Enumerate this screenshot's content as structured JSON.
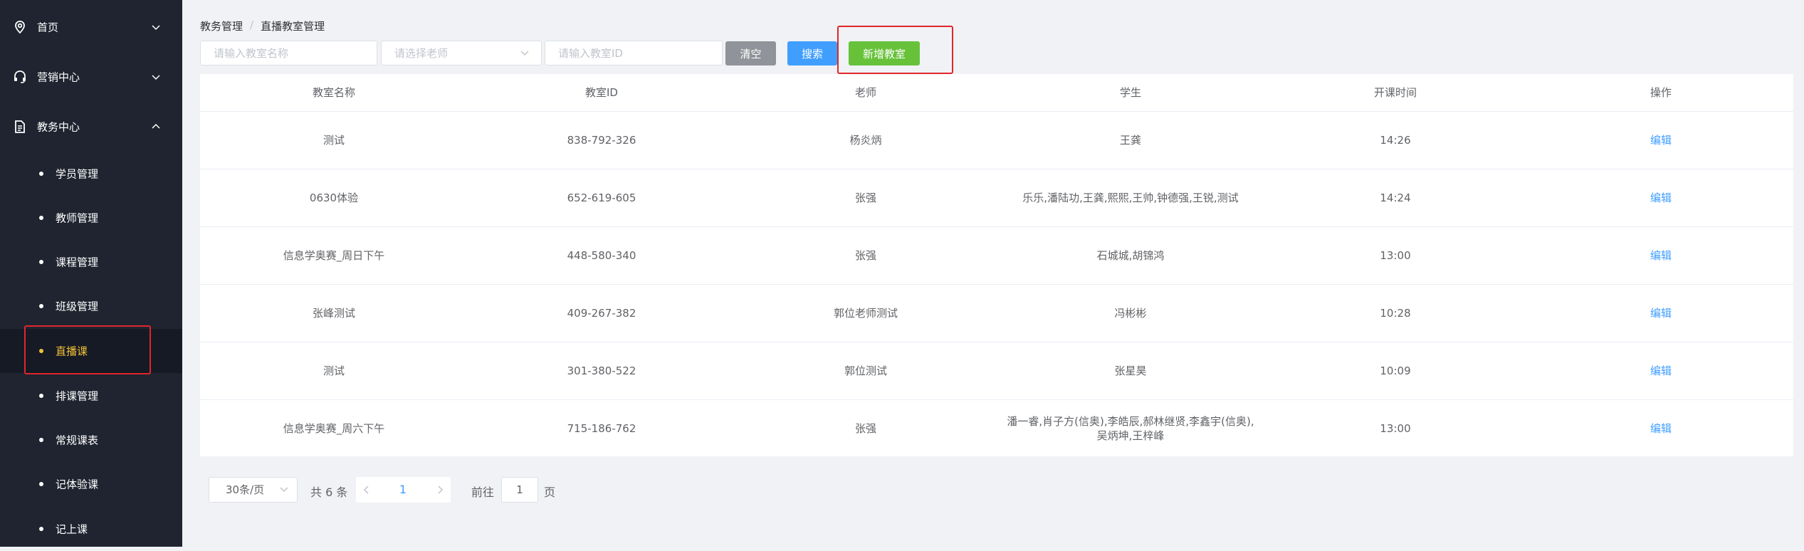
{
  "sidebar": {
    "menus": [
      {
        "label": "首页",
        "icon": "location-pin-icon",
        "state": "collapsed"
      },
      {
        "label": "营销中心",
        "icon": "headset-icon",
        "state": "collapsed"
      },
      {
        "label": "教务中心",
        "icon": "document-icon",
        "state": "expanded"
      }
    ],
    "submenu": [
      {
        "label": "学员管理"
      },
      {
        "label": "教师管理"
      },
      {
        "label": "课程管理"
      },
      {
        "label": "班级管理"
      },
      {
        "label": "直播课",
        "active": true
      },
      {
        "label": "排课管理"
      },
      {
        "label": "常规课表"
      },
      {
        "label": "记体验课"
      },
      {
        "label": "记上课"
      }
    ],
    "active_color": "#f2c037",
    "background": "#1f2430"
  },
  "breadcrumb": {
    "items": [
      "教务管理",
      "直播教室管理"
    ],
    "separator": "/"
  },
  "filters": {
    "name_placeholder": "请输入教室名称",
    "teacher_placeholder": "请选择老师",
    "id_placeholder": "请输入教室ID"
  },
  "buttons": {
    "clear": "清空",
    "search": "搜索",
    "add": "新增教室",
    "clear_color": "#909399",
    "search_color": "#409eff",
    "add_color": "#67c23a"
  },
  "table": {
    "headers": [
      "教室名称",
      "教室ID",
      "老师",
      "学生",
      "开课时间",
      "操作"
    ],
    "rows": [
      {
        "name": "测试",
        "id": "838-792-326",
        "teacher": "杨炎炳",
        "students": "王龚",
        "time": "14:26",
        "action": "编辑"
      },
      {
        "name": "0630体验",
        "id": "652-619-605",
        "teacher": "张强",
        "students": "乐乐,潘陆功,王龚,熙熙,王帅,钟德强,王锐,测试",
        "time": "14:24",
        "action": "编辑"
      },
      {
        "name": "信息学奥赛_周日下午",
        "id": "448-580-340",
        "teacher": "张强",
        "students": "石城城,胡锦鸿",
        "time": "13:00",
        "action": "编辑"
      },
      {
        "name": "张峰测试",
        "id": "409-267-382",
        "teacher": "郭位老师测试",
        "students": "冯彬彬",
        "time": "10:28",
        "action": "编辑"
      },
      {
        "name": "测试",
        "id": "301-380-522",
        "teacher": "郭位测试",
        "students": "张星昊",
        "time": "10:09",
        "action": "编辑"
      },
      {
        "name": "信息学奥赛_周六下午",
        "id": "715-186-762",
        "teacher": "张强",
        "students": "潘一睿,肖子方(信奥),李皓辰,郝林继贤,李鑫宇(信奥),吴炳坤,王梓峰",
        "time": "13:00",
        "action": "编辑"
      }
    ]
  },
  "pagination": {
    "page_size": "30条/页",
    "total": "共 6 条",
    "current_page": "1",
    "goto_label": "前往",
    "goto_value": "1",
    "goto_suffix": "页"
  },
  "highlight_color": "#e0262b"
}
